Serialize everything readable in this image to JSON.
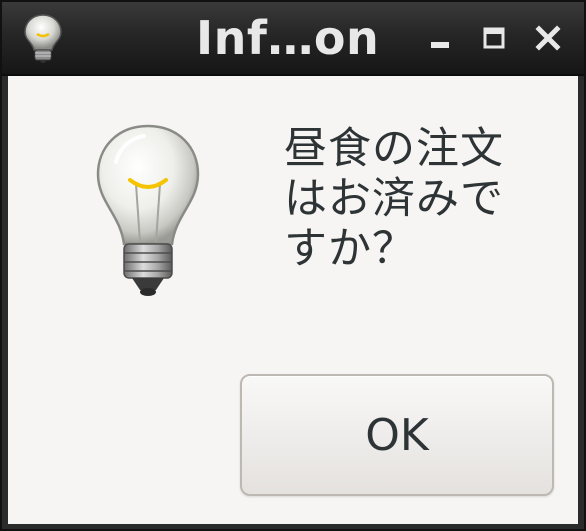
{
  "window": {
    "title": "Inf…on",
    "controls": [
      "minimize",
      "maximize",
      "close"
    ]
  },
  "dialog": {
    "icon": "lightbulb-icon",
    "message": "昼食の注文はお済みですか？",
    "ok_label": "OK"
  },
  "colors": {
    "titlebar": "#1e1e1e",
    "title_text": "#e8e8e8",
    "client_background": "#f6f5f4",
    "text": "#2e3436",
    "button_border": "#bdb8b1"
  }
}
